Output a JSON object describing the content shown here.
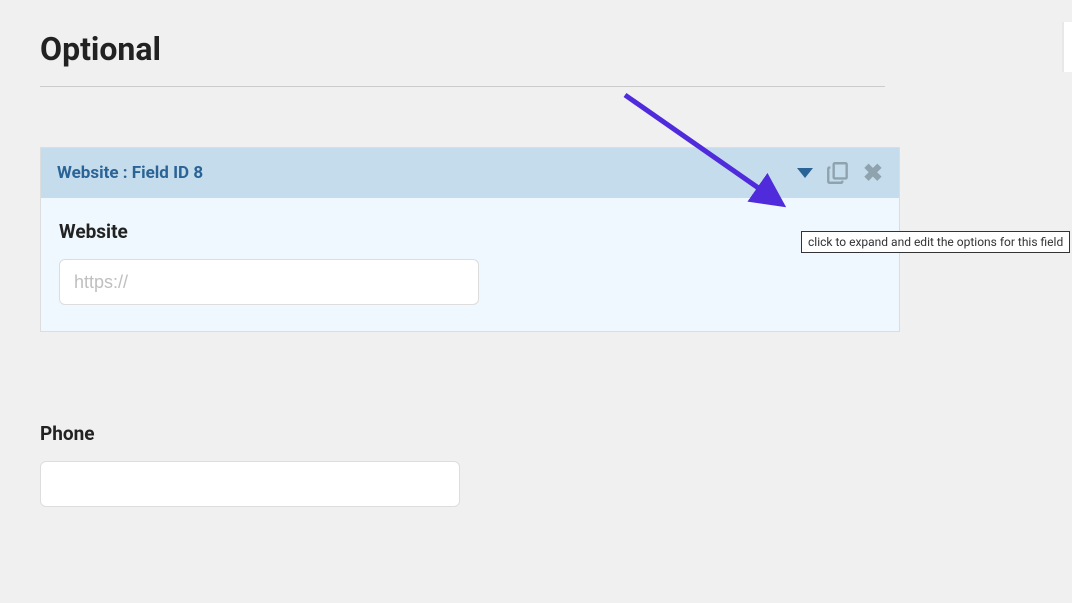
{
  "section": {
    "title": "Optional"
  },
  "field1": {
    "header_text": "Website : Field ID 8",
    "label": "Website",
    "placeholder": "https://"
  },
  "field2": {
    "label": "Phone"
  },
  "tooltip": {
    "text": "click to expand and edit the options for this field"
  }
}
